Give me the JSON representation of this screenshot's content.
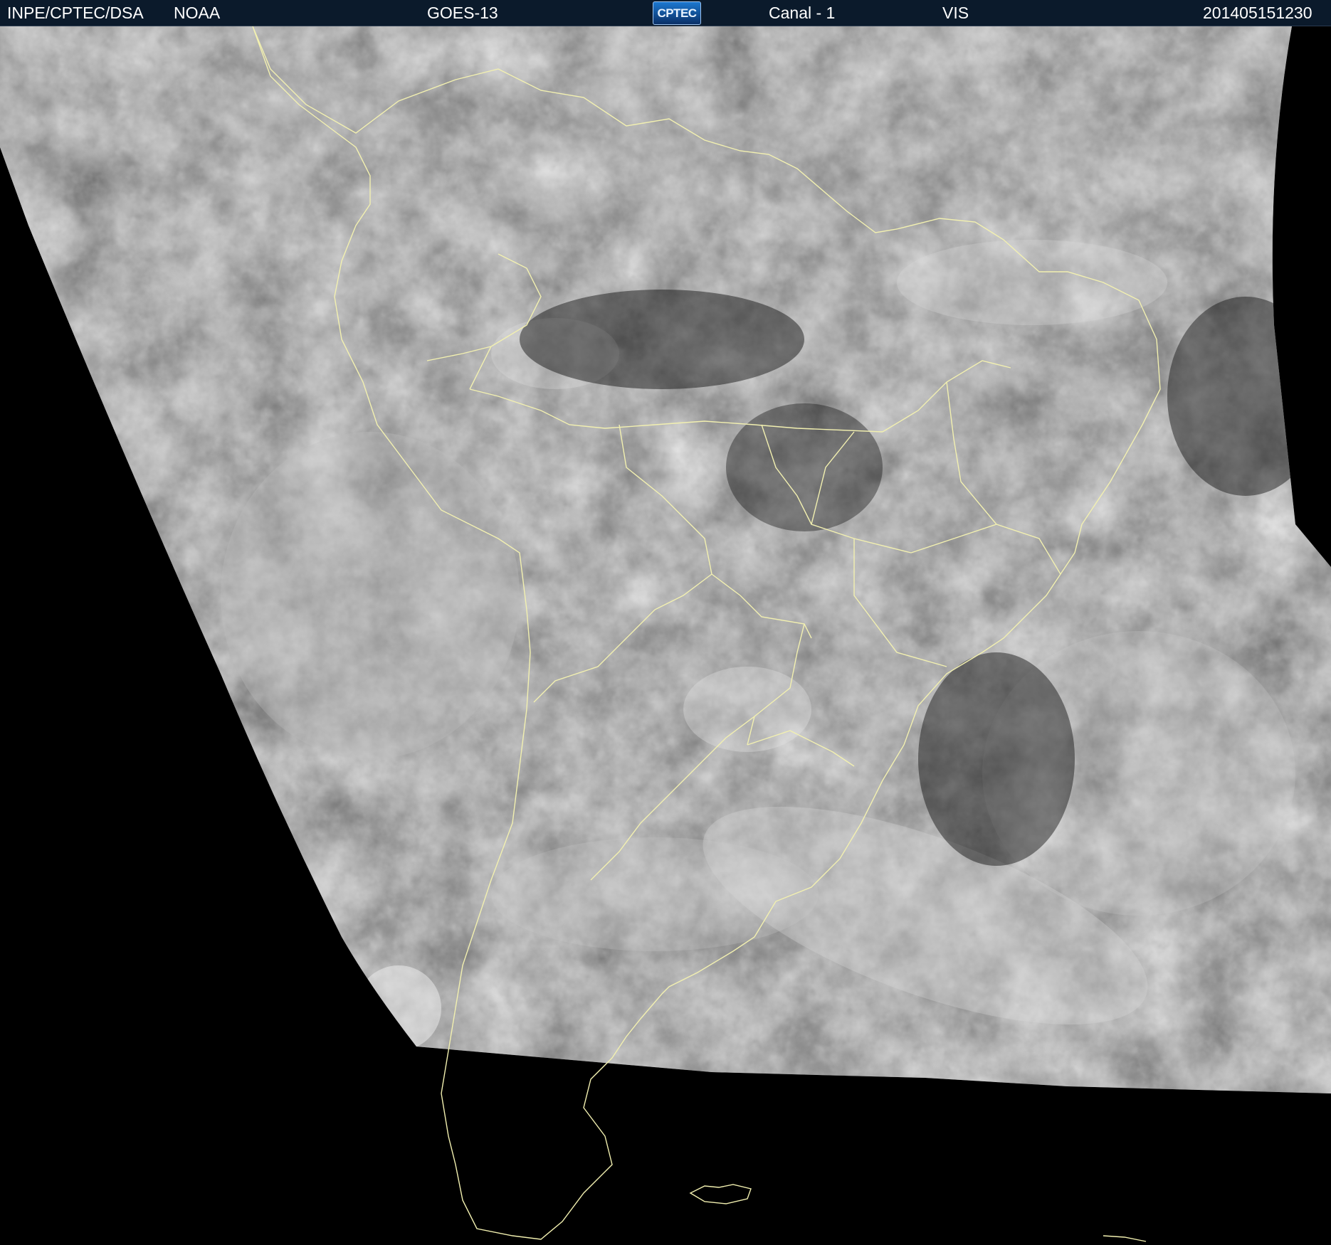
{
  "header": {
    "source": "INPE/CPTEC/DSA",
    "agency": "NOAA",
    "satellite": "GOES-13",
    "logo": "CPTEC",
    "channel": "Canal - 1",
    "band": "VIS",
    "timestamp": "201405151230"
  },
  "colors": {
    "header_background": "#0b1a2b",
    "header_text": "#ffffff",
    "coastline": "#f2f0b0",
    "space": "#000000"
  }
}
